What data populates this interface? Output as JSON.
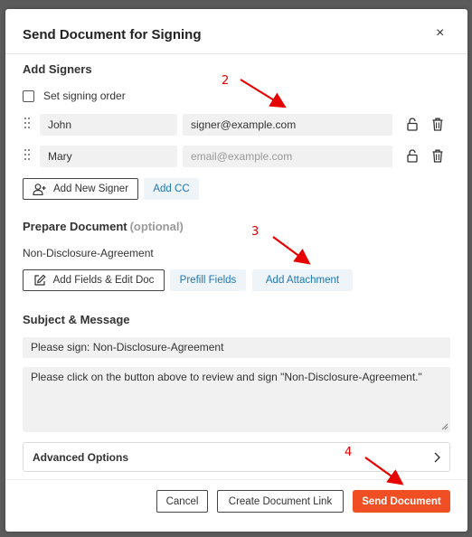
{
  "dialog": {
    "title": "Send Document for Signing",
    "close_symbol": "×"
  },
  "signers": {
    "heading": "Add Signers",
    "order_checkbox": {
      "label": "Set signing order",
      "checked": false
    },
    "rows": [
      {
        "name": "John",
        "email": "signer@example.com",
        "email_placeholder": ""
      },
      {
        "name": "Mary",
        "email": "",
        "email_placeholder": "email@example.com"
      }
    ],
    "add_new_signer_label": "Add New Signer",
    "add_cc_label": "Add CC"
  },
  "prepare": {
    "heading": "Prepare Document",
    "optional_label": "(optional)",
    "document_name": "Non-Disclosure-Agreement",
    "add_fields_label": "Add Fields & Edit Doc",
    "prefill_label": "Prefill Fields",
    "add_attachment_label": "Add Attachment"
  },
  "message": {
    "heading": "Subject & Message",
    "subject": "Please sign: Non-Disclosure-Agreement",
    "body": "Please click on the button above to review and sign \"Non-Disclosure-Agreement.\""
  },
  "advanced": {
    "label": "Advanced Options"
  },
  "footer": {
    "cancel_label": "Cancel",
    "create_link_label": "Create Document Link",
    "send_label": "Send Document"
  },
  "annotations": {
    "step_2": "2",
    "step_3": "3",
    "step_4": "4"
  },
  "colors": {
    "accent": "#f04e23",
    "link": "#2377b4",
    "annotation": "#e60000"
  }
}
